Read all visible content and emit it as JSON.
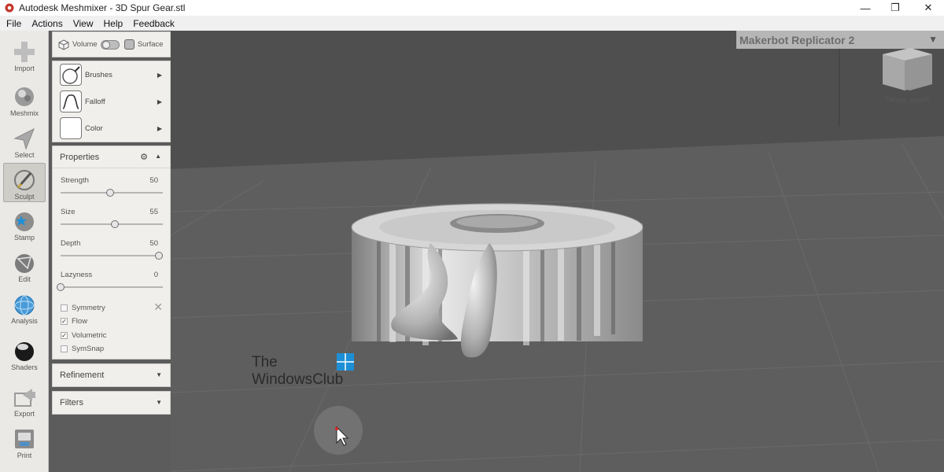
{
  "window": {
    "title": "Autodesk Meshmixer - 3D Spur Gear.stl",
    "minimize_glyph": "—",
    "restore_glyph": "❐",
    "close_glyph": "✕"
  },
  "menu": [
    "File",
    "Actions",
    "View",
    "Help",
    "Feedback"
  ],
  "toolbar": [
    {
      "label": "Import",
      "icon": "plus-icon"
    },
    {
      "label": "Meshmix",
      "icon": "meshmix-icon"
    },
    {
      "label": "Select",
      "icon": "cursor-arrow-icon"
    },
    {
      "label": "Sculpt",
      "icon": "brush-icon",
      "active": true
    },
    {
      "label": "Stamp",
      "icon": "stamp-icon"
    },
    {
      "label": "Edit",
      "icon": "edit-sphere-icon"
    },
    {
      "label": "Analysis",
      "icon": "analysis-sphere-icon"
    },
    {
      "label": "Shaders",
      "icon": "shader-sphere-icon"
    },
    {
      "label": "Export",
      "icon": "export-icon"
    },
    {
      "label": "Print",
      "icon": "printer-icon"
    }
  ],
  "mode_panel": {
    "volume_label": "Volume",
    "surface_label": "Surface"
  },
  "brush_panel": {
    "brushes_label": "Brushes",
    "falloff_label": "Falloff",
    "color_label": "Color"
  },
  "properties": {
    "title": "Properties",
    "sliders": [
      {
        "label": "Strength",
        "value": 50,
        "fraction": 0.5
      },
      {
        "label": "Size",
        "value": 55,
        "fraction": 0.55
      },
      {
        "label": "Depth",
        "value": 50,
        "fraction": 1.0
      },
      {
        "label": "Lazyness",
        "value": 0,
        "fraction": 0.0
      }
    ],
    "checkboxes": [
      {
        "label": "Symmetry",
        "checked": false
      },
      {
        "label": "Flow",
        "checked": true
      },
      {
        "label": "Volumetric",
        "checked": true
      },
      {
        "label": "SymSnap",
        "checked": false
      }
    ]
  },
  "refinement_label": "Refinement",
  "filters_label": "Filters",
  "viewport": {
    "printer": "Makerbot Replicator 2",
    "cube_front": "FRONT",
    "cube_right": "RIGHT"
  },
  "watermark": {
    "line1": "The",
    "line2": "WindowsClub"
  },
  "colors": {
    "accent": "#1d8fd6",
    "viewport_bg": "#5c5c5c",
    "panel_bg": "#f0efec"
  }
}
